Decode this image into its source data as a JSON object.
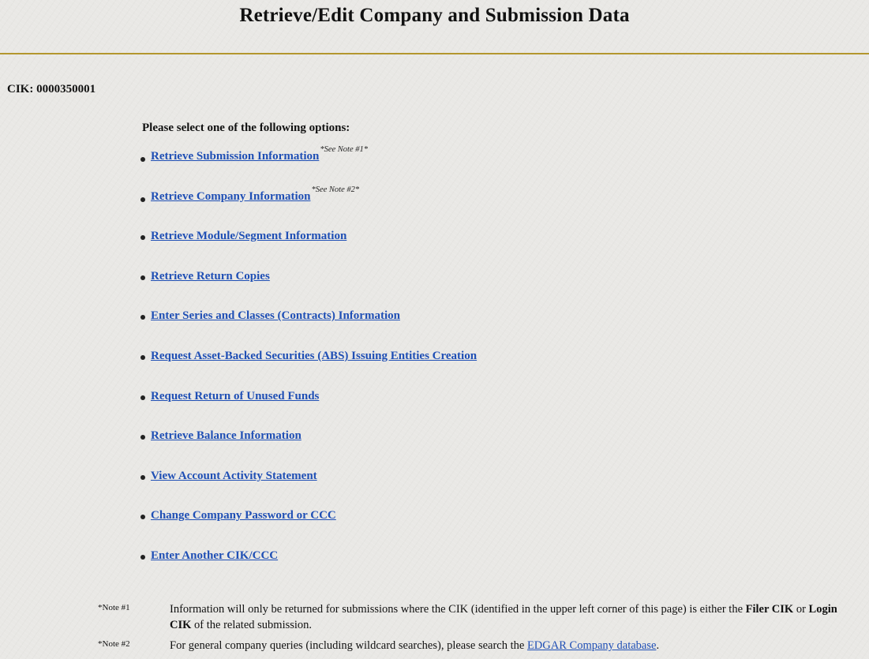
{
  "page": {
    "title": "Retrieve/Edit Company and Submission Data",
    "cik_line": "CIK: 0000350001",
    "prompt": "Please select one of the following options:"
  },
  "options": [
    {
      "label": "Retrieve Submission Information",
      "note_ref": "*See Note #1*"
    },
    {
      "label": "Retrieve Company Information",
      "note_ref": "*See Note #2*"
    },
    {
      "label": "Retrieve Module/Segment Information"
    },
    {
      "label": "Retrieve Return Copies"
    },
    {
      "label": "Enter Series and Classes (Contracts) Information"
    },
    {
      "label": "Request Asset-Backed Securities (ABS) Issuing Entities Creation"
    },
    {
      "label": "Request Return of Unused Funds"
    },
    {
      "label": "Retrieve Balance Information"
    },
    {
      "label": "View Account Activity Statement"
    },
    {
      "label": "Change Company Password or CCC"
    },
    {
      "label": "Enter Another CIK/CCC"
    }
  ],
  "notes": {
    "note1": {
      "label": "*Note #1",
      "text_before": "Information will only be returned for submissions where the CIK (identified in the upper left corner of this page) is either the ",
      "bold1": "Filer CIK",
      "text_mid": " or ",
      "bold2": "Login CIK",
      "text_after": " of the related submission."
    },
    "note2": {
      "label": "*Note #2",
      "text_before": "For general company queries (including wildcard searches), please search the ",
      "link": "EDGAR Company database",
      "text_after": "."
    }
  },
  "colors": {
    "link": "#1f4fb5",
    "rule": "#b3962e",
    "background": "#e9e8e5"
  }
}
